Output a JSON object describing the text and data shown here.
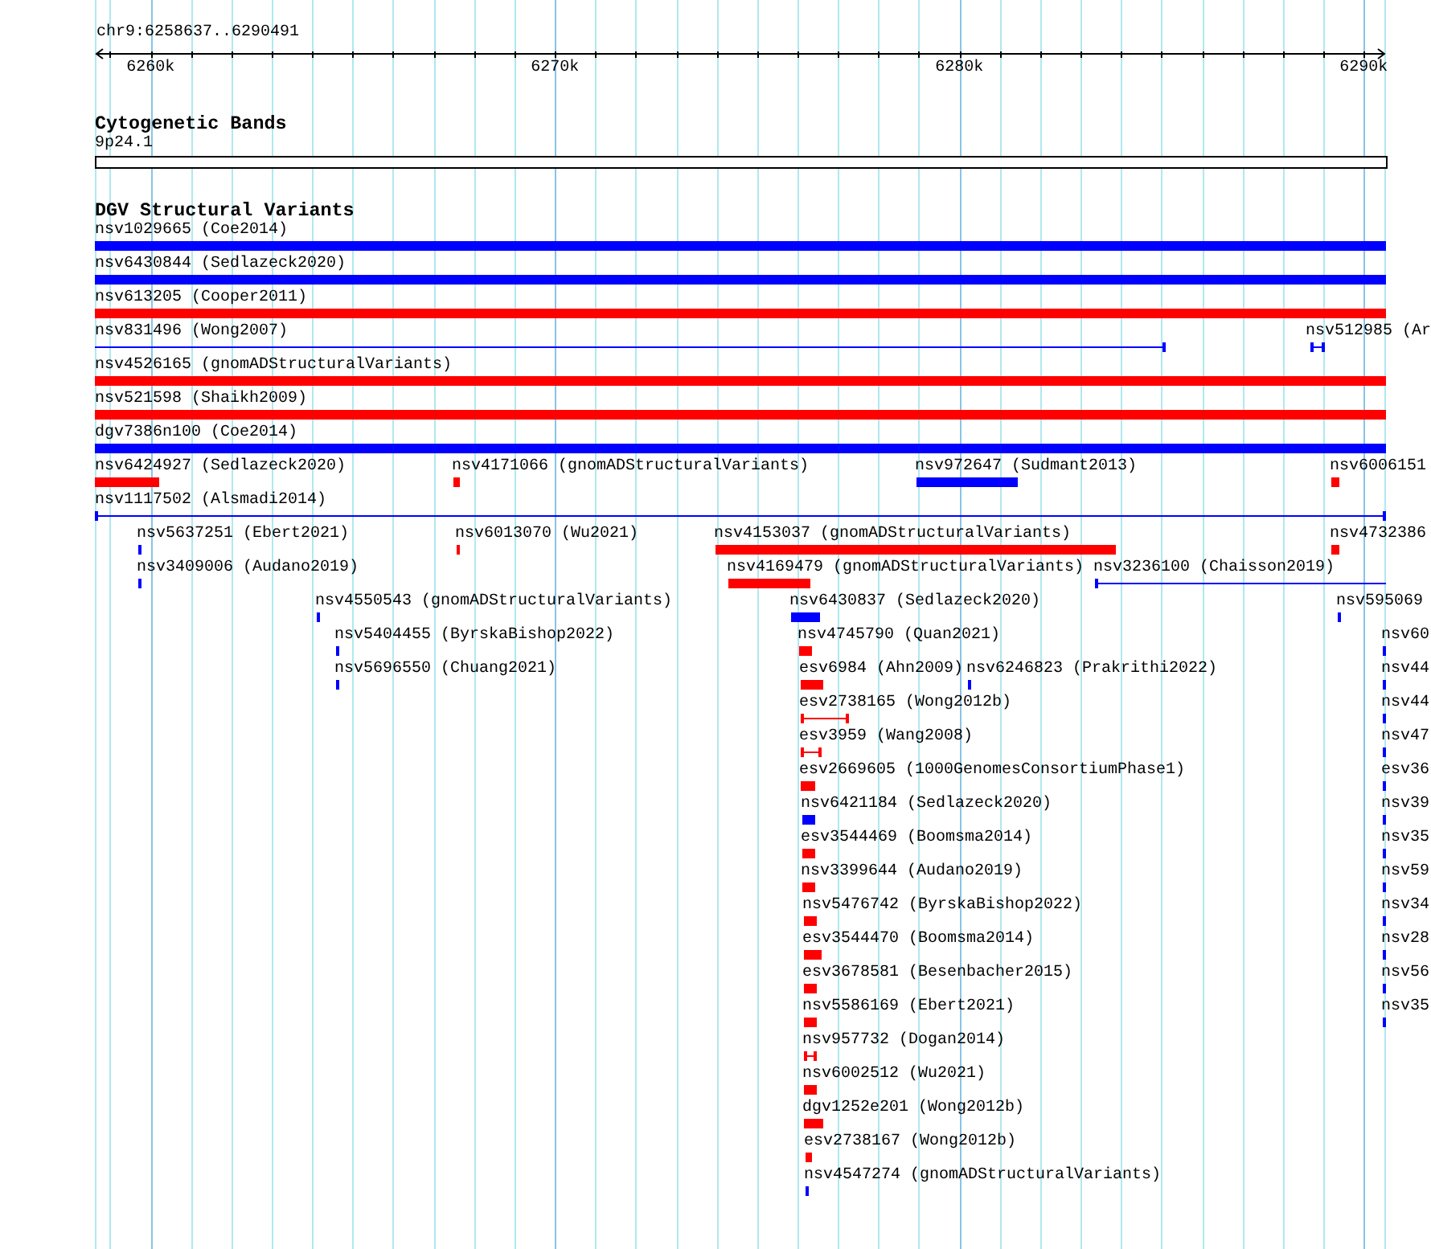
{
  "location": "chr9:6258637..6290491",
  "ruler": {
    "ticks": [
      "6260k",
      "6270k",
      "6280k",
      "6290k"
    ]
  },
  "tracks": [
    {
      "title": "Cytogenetic Bands",
      "features": [
        {
          "label": "9p24.1",
          "kind": "band"
        }
      ]
    },
    {
      "title": "DGV Structural Variants",
      "features": [
        {
          "label": "nsv1029665 (Coe2014)",
          "kind": "bar",
          "color": "#0000ff"
        },
        {
          "label": "nsv6430844 (Sedlazeck2020)",
          "kind": "bar",
          "color": "#0000ff"
        },
        {
          "label": "nsv613205 (Cooper2011)",
          "kind": "bar",
          "color": "#ff0000"
        },
        {
          "label": "nsv831496 (Wong2007)",
          "kind": "span",
          "color": "#0000ff"
        },
        {
          "label": "nsv512985 (Ar",
          "kind": "span",
          "color": "#0000ff"
        },
        {
          "label": "nsv4526165 (gnomADStructuralVariants)",
          "kind": "bar",
          "color": "#ff0000"
        },
        {
          "label": "nsv521598 (Shaikh2009)",
          "kind": "bar",
          "color": "#ff0000"
        },
        {
          "label": "dgv7386n100 (Coe2014)",
          "kind": "bar",
          "color": "#0000ff"
        },
        {
          "label": "nsv6424927 (Sedlazeck2020)",
          "kind": "bar",
          "color": "#ff0000"
        },
        {
          "label": "nsv4171066 (gnomADStructuralVariants)",
          "kind": "bar",
          "color": "#ff0000"
        },
        {
          "label": "nsv972647 (Sudmant2013)",
          "kind": "bar",
          "color": "#0000ff"
        },
        {
          "label": "nsv6006151",
          "kind": "bar",
          "color": "#ff0000"
        },
        {
          "label": "nsv1117502 (Alsmadi2014)",
          "kind": "span",
          "color": "#0000ff"
        },
        {
          "label": "nsv5637251 (Ebert2021)",
          "kind": "bar",
          "color": "#0000ff"
        },
        {
          "label": "nsv6013070 (Wu2021)",
          "kind": "bar",
          "color": "#ff0000"
        },
        {
          "label": "nsv4153037 (gnomADStructuralVariants)",
          "kind": "bar",
          "color": "#ff0000"
        },
        {
          "label": "nsv4732386",
          "kind": "bar",
          "color": "#ff0000"
        },
        {
          "label": "nsv3409006 (Audano2019)",
          "kind": "bar",
          "color": "#0000ff"
        },
        {
          "label": "nsv4169479 (gnomADStructuralVariants)",
          "kind": "bar",
          "color": "#ff0000"
        },
        {
          "label": "nsv3236100 (Chaisson2019)",
          "kind": "span",
          "color": "#0000ff"
        },
        {
          "label": "nsv4550543 (gnomADStructuralVariants)",
          "kind": "bar",
          "color": "#0000ff"
        },
        {
          "label": "nsv6430837 (Sedlazeck2020)",
          "kind": "bar",
          "color": "#0000ff"
        },
        {
          "label": "nsv595069",
          "kind": "bar",
          "color": "#0000ff"
        },
        {
          "label": "nsv5404455 (ByrskaBishop2022)",
          "kind": "bar",
          "color": "#0000ff"
        },
        {
          "label": "nsv4745790 (Quan2021)",
          "kind": "bar",
          "color": "#ff0000"
        },
        {
          "label": "nsv60",
          "kind": "bar",
          "color": "#0000ff"
        },
        {
          "label": "nsv5696550 (Chuang2021)",
          "kind": "bar",
          "color": "#0000ff"
        },
        {
          "label": "esv6984 (Ahn2009)",
          "kind": "bar",
          "color": "#ff0000"
        },
        {
          "label": "nsv6246823 (Prakrithi2022)",
          "kind": "bar",
          "color": "#0000ff"
        },
        {
          "label": "nsv44",
          "kind": "bar",
          "color": "#0000ff"
        },
        {
          "label": "esv2738165 (Wong2012b)",
          "kind": "span",
          "color": "#ff0000"
        },
        {
          "label": "nsv44",
          "kind": "bar",
          "color": "#0000ff"
        },
        {
          "label": "esv3959 (Wang2008)",
          "kind": "span",
          "color": "#ff0000"
        },
        {
          "label": "nsv47",
          "kind": "bar",
          "color": "#0000ff"
        },
        {
          "label": "esv2669605 (1000GenomesConsortiumPhase1)",
          "kind": "bar",
          "color": "#ff0000"
        },
        {
          "label": "esv36",
          "kind": "bar",
          "color": "#0000ff"
        },
        {
          "label": "nsv6421184 (Sedlazeck2020)",
          "kind": "bar",
          "color": "#0000ff"
        },
        {
          "label": "nsv39",
          "kind": "bar",
          "color": "#0000ff"
        },
        {
          "label": "esv3544469 (Boomsma2014)",
          "kind": "bar",
          "color": "#ff0000"
        },
        {
          "label": "nsv35",
          "kind": "bar",
          "color": "#0000ff"
        },
        {
          "label": "nsv3399644 (Audano2019)",
          "kind": "bar",
          "color": "#ff0000"
        },
        {
          "label": "nsv59",
          "kind": "bar",
          "color": "#0000ff"
        },
        {
          "label": "nsv5476742 (ByrskaBishop2022)",
          "kind": "bar",
          "color": "#ff0000"
        },
        {
          "label": "nsv34",
          "kind": "bar",
          "color": "#0000ff"
        },
        {
          "label": "esv3544470 (Boomsma2014)",
          "kind": "bar",
          "color": "#ff0000"
        },
        {
          "label": "nsv28",
          "kind": "bar",
          "color": "#0000ff"
        },
        {
          "label": "esv3678581 (Besenbacher2015)",
          "kind": "bar",
          "color": "#ff0000"
        },
        {
          "label": "nsv56",
          "kind": "bar",
          "color": "#0000ff"
        },
        {
          "label": "nsv5586169 (Ebert2021)",
          "kind": "bar",
          "color": "#ff0000"
        },
        {
          "label": "nsv35",
          "kind": "bar",
          "color": "#0000ff"
        },
        {
          "label": "nsv957732 (Dogan2014)",
          "kind": "span",
          "color": "#ff0000"
        },
        {
          "label": "nsv6002512 (Wu2021)",
          "kind": "bar",
          "color": "#ff0000"
        },
        {
          "label": "dgv1252e201 (Wong2012b)",
          "kind": "bar",
          "color": "#ff0000"
        },
        {
          "label": "esv2738167 (Wong2012b)",
          "kind": "bar",
          "color": "#ff0000"
        },
        {
          "label": "nsv4547274 (gnomADStructuralVariants)",
          "kind": "bar",
          "color": "#0000ff"
        }
      ]
    }
  ]
}
